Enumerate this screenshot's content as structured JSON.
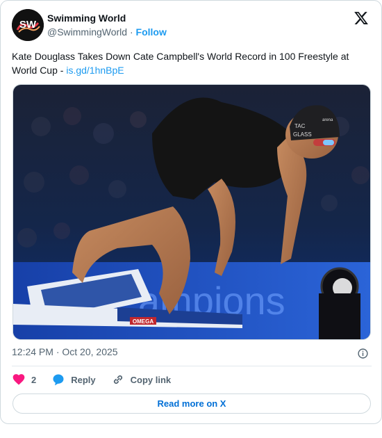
{
  "author": {
    "display_name": "Swimming World",
    "handle": "@SwimmingWorld",
    "separator": "·",
    "follow_label": "Follow",
    "avatar_text": "SW"
  },
  "tweet": {
    "text": "Kate Douglass Takes Down Cate Campbell's World Record in 100 Freestyle at World Cup - ",
    "link_text": "is.gd/1hnBpE"
  },
  "media": {
    "cap_text_1": "TAC",
    "cap_text_2": "GLASS",
    "cap_brand": "arena",
    "block_brand": "OMEGA",
    "banner_text": "ampions"
  },
  "timestamp": {
    "time": "12:24 PM",
    "separator": "·",
    "date": "Oct 20, 2025"
  },
  "actions": {
    "like_count": "2",
    "reply_label": "Reply",
    "copy_label": "Copy link"
  },
  "read_more_label": "Read more on X",
  "colors": {
    "accent": "#1d9bf0",
    "like": "#f91880",
    "muted": "#536471"
  }
}
